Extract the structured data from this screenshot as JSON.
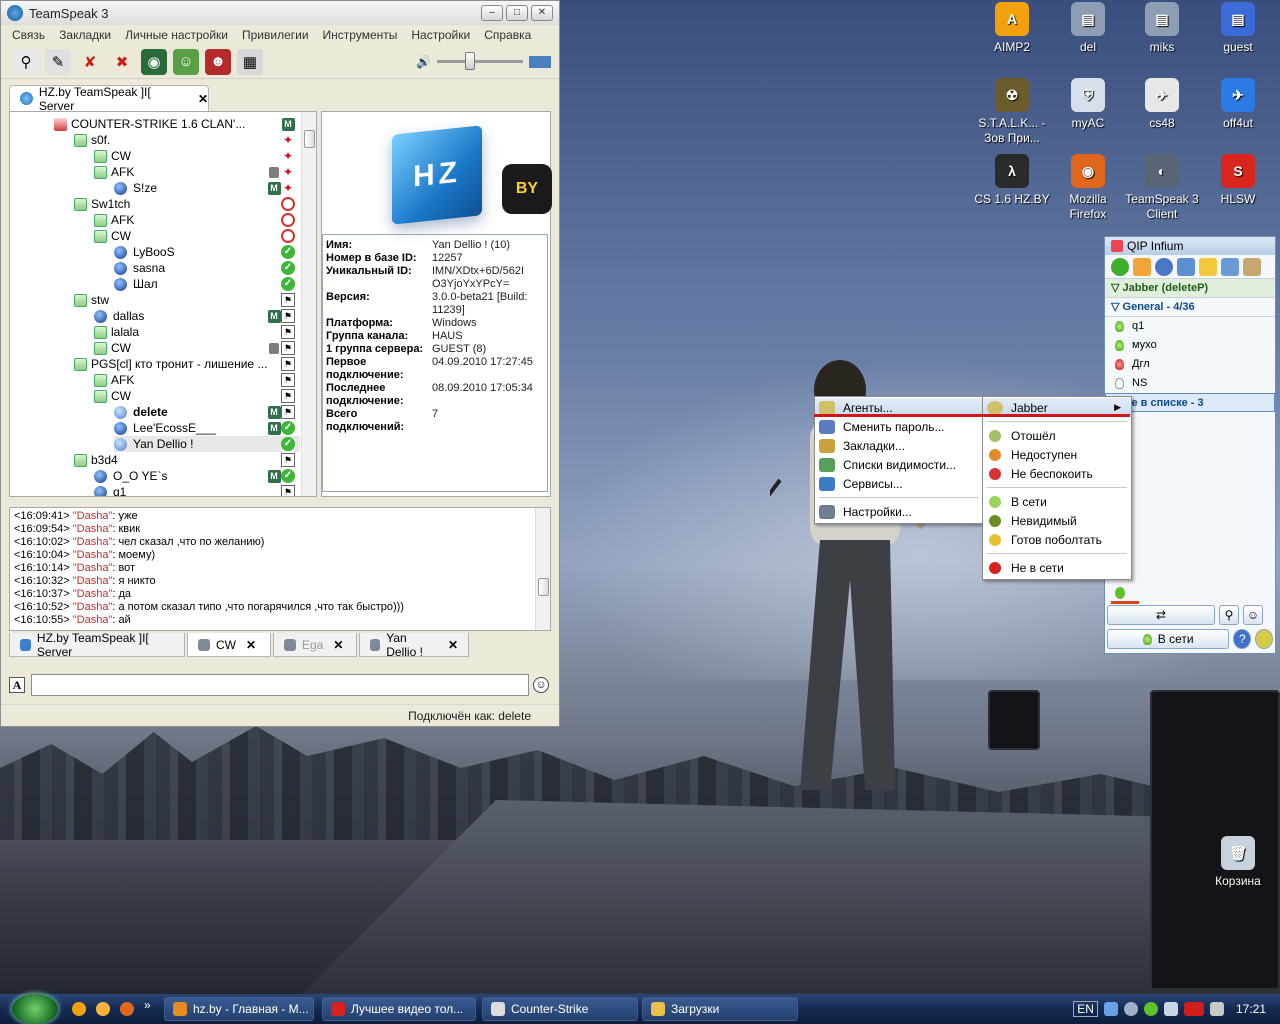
{
  "teamspeak": {
    "title": "TeamSpeak 3",
    "menu": [
      "Связь",
      "Закладки",
      "Личные настройки",
      "Привилегии",
      "Инструменты",
      "Настройки",
      "Справка"
    ],
    "server_tab": "HZ.by TeamSpeak ]I[ Server",
    "tree": [
      {
        "label": "COUNTER-STRIKE 1.6 CLAN'...",
        "kind": "server"
      },
      {
        "label": "s0f.",
        "kind": "channel"
      },
      {
        "label": "CW",
        "kind": "channel"
      },
      {
        "label": "AFK",
        "kind": "channel"
      },
      {
        "label": "S!ze",
        "kind": "user"
      },
      {
        "label": "Sw1tch",
        "kind": "channel"
      },
      {
        "label": "AFK",
        "kind": "channel"
      },
      {
        "label": "CW",
        "kind": "channel"
      },
      {
        "label": "LyBooS",
        "kind": "user"
      },
      {
        "label": "sasna",
        "kind": "user"
      },
      {
        "label": "Шал",
        "kind": "user"
      },
      {
        "label": "stw",
        "kind": "channel"
      },
      {
        "label": "dallas",
        "kind": "user"
      },
      {
        "label": "lalala",
        "kind": "channel"
      },
      {
        "label": "CW",
        "kind": "channel"
      },
      {
        "label": "PGS[cl] кто тронит - лишение ...",
        "kind": "channel"
      },
      {
        "label": "AFK",
        "kind": "channel"
      },
      {
        "label": "CW",
        "kind": "channel"
      },
      {
        "label": "delete",
        "kind": "user"
      },
      {
        "label": "Lee'EcossE___",
        "kind": "user"
      },
      {
        "label": "Yan Dellio !",
        "kind": "user"
      },
      {
        "label": "b3d4",
        "kind": "channel"
      },
      {
        "label": "O_O YE`s",
        "kind": "user"
      },
      {
        "label": "q1",
        "kind": "user"
      }
    ],
    "info": {
      "rows": [
        {
          "k": "Имя:",
          "v": "Yan Dellio ! (10)"
        },
        {
          "k": "Номер в базе ID:",
          "v": "12257"
        },
        {
          "k": "Уникальный ID:",
          "v": "IMN/XDtx+6D/562I O3YjoYxYPcY="
        },
        {
          "k": "Версия:",
          "v": "3.0.0-beta21 [Build: 11239]"
        },
        {
          "k": "Платформа:",
          "v": "Windows"
        },
        {
          "k": "Группа канала:",
          "v": "HAUS"
        },
        {
          "k": "1 группа сервера:",
          "v": "GUEST (8)"
        },
        {
          "k": "Первое подключение:",
          "v": "04.09.2010 17:27:45"
        },
        {
          "k": "Последнее подключение:",
          "v": "08.09.2010 17:05:34"
        },
        {
          "k": "Всего подключений:",
          "v": "7"
        }
      ]
    },
    "chat": [
      {
        "t": "<16:09:41>",
        "n": "\"Dasha\"",
        "m": ": уже"
      },
      {
        "t": "<16:09:54>",
        "n": "\"Dasha\"",
        "m": ": квик"
      },
      {
        "t": "<16:10:02>",
        "n": "\"Dasha\"",
        "m": ": чел сказал ,что по желанию)"
      },
      {
        "t": "<16:10:04>",
        "n": "\"Dasha\"",
        "m": ": моему)"
      },
      {
        "t": "<16:10:14>",
        "n": "\"Dasha\"",
        "m": ": вот"
      },
      {
        "t": "<16:10:32>",
        "n": "\"Dasha\"",
        "m": ": я никто"
      },
      {
        "t": "<16:10:37>",
        "n": "\"Dasha\"",
        "m": ": да"
      },
      {
        "t": "<16:10:52>",
        "n": "\"Dasha\"",
        "m": ": а потом сказал типо ,что погарячился ,что так быстро)))"
      },
      {
        "t": "<16:10:55>",
        "n": "\"Dasha\"",
        "m": ": ай"
      }
    ],
    "chat_tabs": [
      {
        "label": "HZ.by TeamSpeak ]I[ Server"
      },
      {
        "label": "CW"
      },
      {
        "label": "Ega"
      },
      {
        "label": "Yan Dellio !"
      }
    ],
    "status": "Подключён как: delete"
  },
  "desktop_icons": [
    {
      "label": "AIMP2",
      "color": "#f2a10c",
      "glyph": "A"
    },
    {
      "label": "del",
      "color": "#8d9db3",
      "glyph": "▤"
    },
    {
      "label": "miks",
      "color": "#8d9db3",
      "glyph": "▤"
    },
    {
      "label": "guest",
      "color": "#3a6bd6",
      "glyph": "▤"
    },
    {
      "label": "S.T.A.L.K... - Зов При...",
      "color": "#6b5a2a",
      "glyph": "☢"
    },
    {
      "label": "myAC",
      "color": "#d7dfea",
      "glyph": "⛨"
    },
    {
      "label": "cs48",
      "color": "#e7e7e7",
      "glyph": "✈"
    },
    {
      "label": "off4ut",
      "color": "#2c7be5",
      "glyph": "✈"
    },
    {
      "label": "CS 1.6 HZ.BY",
      "color": "#2a2a2a",
      "glyph": "λ"
    },
    {
      "label": "Mozilla Firefox",
      "color": "#e0661b",
      "glyph": "◉"
    },
    {
      "label": "TeamSpeak 3 Client",
      "color": "#596577",
      "glyph": "◐"
    },
    {
      "label": "HLSW",
      "color": "#d8261f",
      "glyph": "S"
    },
    {
      "label": "Корзина",
      "color": "#c8d2dc",
      "glyph": "🗑"
    }
  ],
  "qip": {
    "title": "QIP Infium",
    "account": "Jabber (deleteP)",
    "group": "General - 4/36",
    "contacts": [
      {
        "name": "q1",
        "state": "online"
      },
      {
        "name": "мухо",
        "state": "online"
      },
      {
        "name": "Дгл",
        "state": "offline"
      },
      {
        "name": "NS",
        "state": "unknown"
      }
    ],
    "notlist": "Не в списке - 3",
    "status_button": "В сети"
  },
  "menu_left": [
    {
      "label": "Агенты...",
      "color": "#cfc06a"
    },
    {
      "label": "Сменить пароль...",
      "color": "#5a7bbf"
    },
    {
      "label": "Закладки...",
      "color": "#c9a23e"
    },
    {
      "label": "Списки видимости...",
      "color": "#57a05a"
    },
    {
      "label": "Сервисы...",
      "color": "#3c7cc7"
    },
    {
      "label": "Настройки...",
      "color": "#6f7f93"
    }
  ],
  "menu_right": {
    "header": "Jabber",
    "items": [
      {
        "label": "Отошёл",
        "color": "#a0c06a"
      },
      {
        "label": "Недоступен",
        "color": "#e08b2b"
      },
      {
        "label": "Не беспокоить",
        "color": "#d83232"
      },
      {
        "label": "В сети",
        "color": "#9bd35a"
      },
      {
        "label": "Невидимый",
        "color": "#6b8e23"
      },
      {
        "label": "Готов поболтать",
        "color": "#e2c233"
      },
      {
        "label": "Не в сети",
        "color": "#d82020"
      }
    ]
  },
  "taskbar": {
    "items": [
      {
        "label": "hz.by - Главная - M...",
        "color": "#e58b20"
      },
      {
        "label": "Лучшее видео тол...",
        "color": "#d82020"
      },
      {
        "label": "Counter-Strike",
        "color": "#dcdcdc"
      },
      {
        "label": "Загрузки",
        "color": "#e9c14b"
      }
    ],
    "lang": "EN",
    "time": "17:21"
  }
}
